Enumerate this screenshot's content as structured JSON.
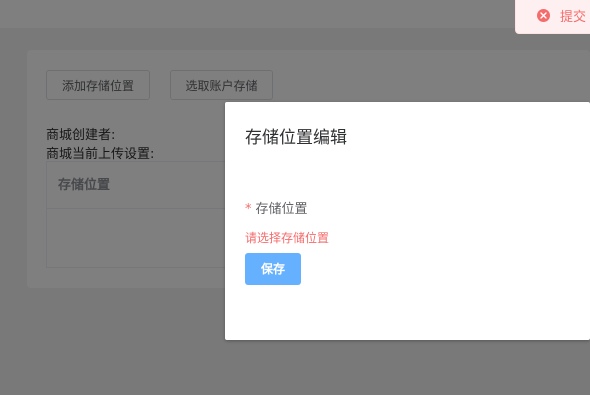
{
  "toolbar": {
    "add_storage_label": "添加存储位置",
    "select_account_storage_label": "选取账户存储"
  },
  "info": {
    "creator_label": "商城创建者:",
    "upload_setting_label": "商城当前上传设置:"
  },
  "table": {
    "columns": [
      "存储位置"
    ]
  },
  "dialog": {
    "title": "存储位置编辑",
    "field_label": "存储位置",
    "required_mark": "*",
    "error_text": "请选择存储位置",
    "save_label": "保存"
  },
  "toast": {
    "message": "提交"
  },
  "icons": {
    "toast_icon": "error-circle-icon"
  },
  "colors": {
    "primary_button": "#66b1ff",
    "error": "#f56c6c",
    "toast_background": "#fef0f0"
  }
}
